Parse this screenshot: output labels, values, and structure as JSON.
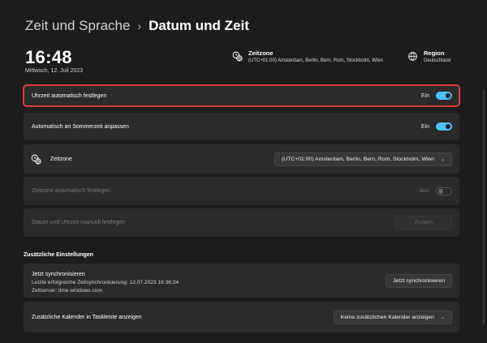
{
  "header": {
    "parent": "Zeit und Sprache",
    "separator": "›",
    "current": "Datum und Zeit"
  },
  "clock": {
    "time": "16:48",
    "date": "Mittwoch, 12. Juli 2023"
  },
  "info": {
    "timezone_label": "Zeitzone",
    "timezone_value": "(UTC+01:00) Amsterdam, Berlin, Bern, Rom, Stockholm, Wien",
    "region_label": "Region",
    "region_value": "Deutschland"
  },
  "rows": {
    "auto_time": {
      "label": "Uhrzeit automatisch festlegen",
      "state": "Ein",
      "on": true
    },
    "dst": {
      "label": "Automatisch an Sommerzeit anpassen",
      "state": "Ein",
      "on": true
    },
    "timezone": {
      "label": "Zeitzone",
      "value": "(UTC+01:00) Amsterdam, Berlin, Bern, Rom, Stockholm, Wien",
      "chevron": "⌄"
    },
    "auto_tz": {
      "label": "Zeitzone automatisch festlegen",
      "state": "Aus",
      "on": false
    },
    "manual": {
      "label": "Datum und Uhrzeit manuell festlegen",
      "button": "Ändern"
    }
  },
  "additional": {
    "title": "Zusätzliche Einstellungen",
    "sync": {
      "title": "Jetzt synchronisieren",
      "last": "Letzte erfolgreiche Zeitsynchronisierung: 12.07.2023 16:36:24",
      "server": "Zeitserver: time.windows.com",
      "button": "Jetzt synchronisieren"
    },
    "calendar": {
      "label": "Zusätzliche Kalender in Taskleiste anzeigen",
      "value": "Keine zusätzlichen Kalender anzeigen",
      "chevron": "⌄"
    }
  },
  "colors": {
    "accent": "#4cc2ff",
    "highlight": "#e03a3a",
    "background": "#1c1c1c",
    "card": "#2b2b2b"
  },
  "icons": [
    "timezone-clock-icon",
    "globe-icon",
    "chevron-down-icon"
  ]
}
